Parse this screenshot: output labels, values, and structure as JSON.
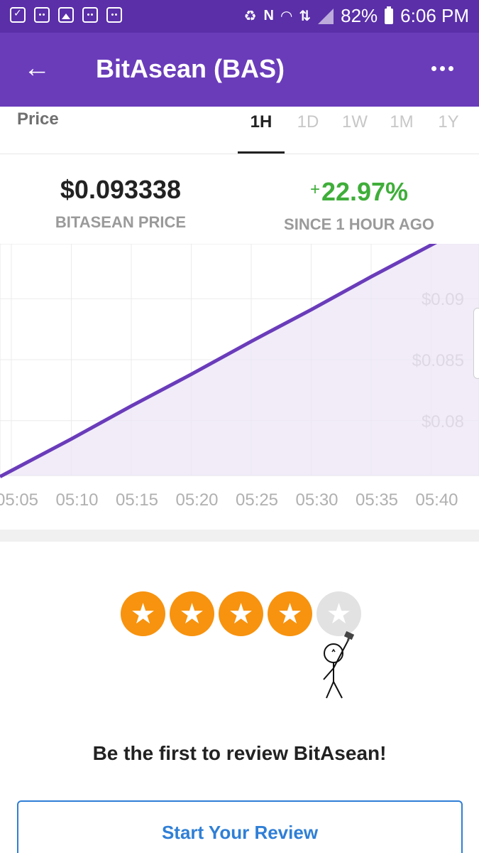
{
  "status_bar": {
    "battery": "82%",
    "time": "6:06 PM",
    "left_icons": [
      "task-icon",
      "chat-icon",
      "gallery-icon",
      "chat-icon",
      "chat-icon"
    ],
    "right_icons": [
      "recycle-icon",
      "nfc-icon",
      "wifi-icon",
      "data-icon",
      "signal-icon",
      "battery-icon"
    ]
  },
  "app_bar": {
    "title": "BitAsean (BAS)"
  },
  "price_card": {
    "section_label": "Price",
    "tabs": [
      "1H",
      "1D",
      "1W",
      "1M",
      "1Y"
    ],
    "active_tab": "1H",
    "price": {
      "value": "$0.093338",
      "caption": "BITASEAN PRICE"
    },
    "change": {
      "sign": "+",
      "value": "22.97%",
      "caption": "SINCE 1 HOUR AGO",
      "color": "#3fae3a"
    }
  },
  "chart_data": {
    "type": "area",
    "x": [
      "05:05",
      "05:10",
      "05:15",
      "05:20",
      "05:25",
      "05:30",
      "05:35",
      "05:40"
    ],
    "y_ticks": [
      "$0.08",
      "$0.085",
      "$0.09"
    ],
    "ylim": [
      0.0755,
      0.0945
    ],
    "series": [
      {
        "values": [
          0.0759,
          0.0785,
          0.0812,
          0.0838,
          0.0865,
          0.0891,
          0.0918,
          0.0944
        ]
      }
    ],
    "line_color": "#6a3cba",
    "fill_color": "#ece6f6",
    "grid": true
  },
  "review": {
    "rating": 4,
    "max_rating": 5,
    "headline": "Be the first to review BitAsean!",
    "button_label": "Start Your Review"
  },
  "colors": {
    "status_bar": "#5a2fa8",
    "app_bar": "#6a3cba",
    "star_filled": "#f7930f",
    "star_empty": "#e2e2e2",
    "link_blue": "#2f7fd6"
  }
}
